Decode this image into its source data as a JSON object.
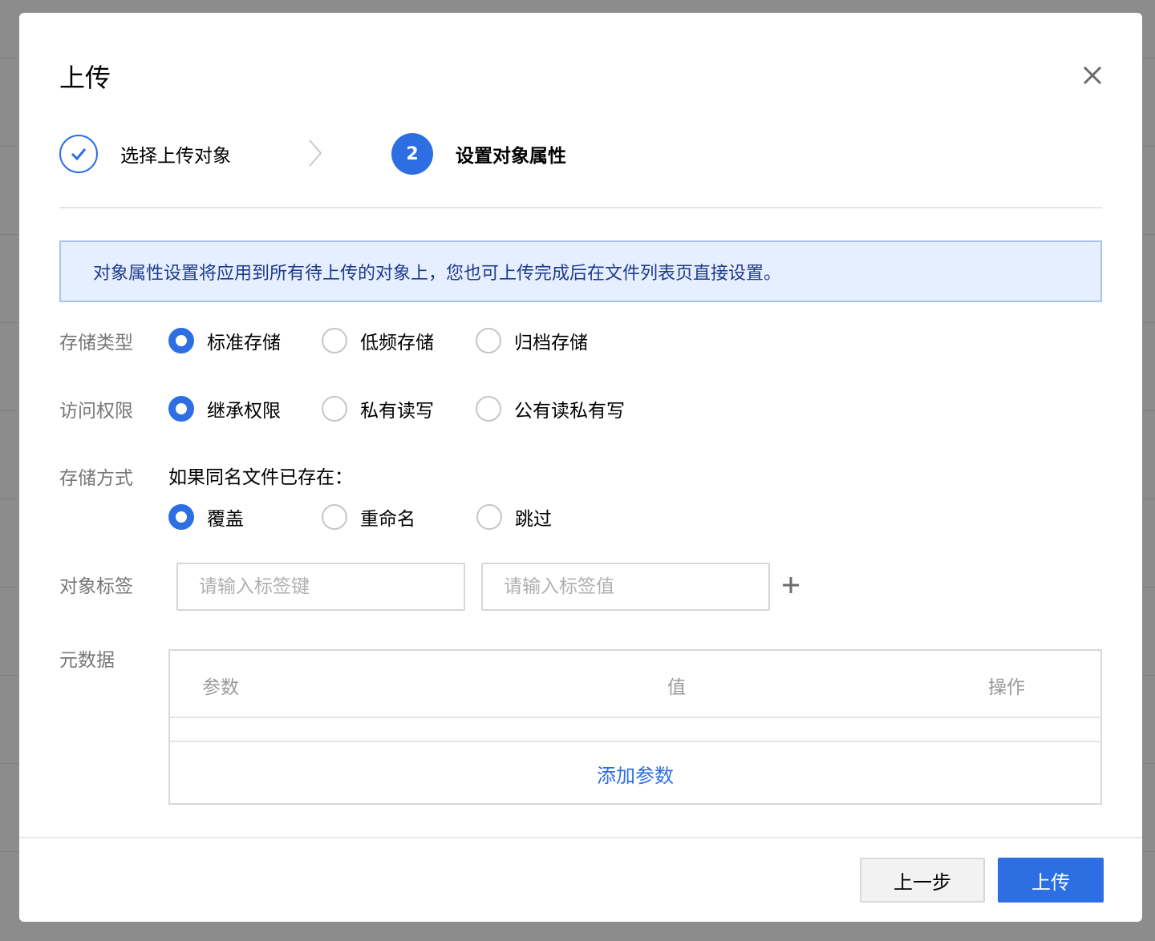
{
  "modal": {
    "title": "上传",
    "steps": [
      {
        "label": "选择上传对象",
        "state": "done",
        "icon": "check-icon"
      },
      {
        "label": "设置对象属性",
        "state": "active",
        "number": "2"
      }
    ],
    "info": "对象属性设置将应用到所有待上传的对象上，您也可上传完成后在文件列表页直接设置。",
    "storage_type": {
      "label": "存储类型",
      "options": [
        "标准存储",
        "低频存储",
        "归档存储"
      ],
      "selected": "标准存储"
    },
    "access": {
      "label": "访问权限",
      "options": [
        "继承权限",
        "私有读写",
        "公有读私有写"
      ],
      "selected": "继承权限"
    },
    "storage_mode": {
      "label": "存储方式",
      "hint": "如果同名文件已存在：",
      "options": [
        "覆盖",
        "重命名",
        "跳过"
      ],
      "selected": "覆盖"
    },
    "tags": {
      "label": "对象标签",
      "key_placeholder": "请输入标签键",
      "value_placeholder": "请输入标签值",
      "add_icon": "plus-icon"
    },
    "metadata": {
      "label": "元数据",
      "columns": [
        "参数",
        "值",
        "操作"
      ],
      "add_label": "添加参数"
    },
    "buttons": {
      "prev": "上一步",
      "upload": "上传"
    }
  },
  "colors": {
    "primary": "#2d6fe3",
    "info_bg": "#e6efff",
    "info_border": "#a7c4f0",
    "overlay": "#8c8c8c"
  }
}
